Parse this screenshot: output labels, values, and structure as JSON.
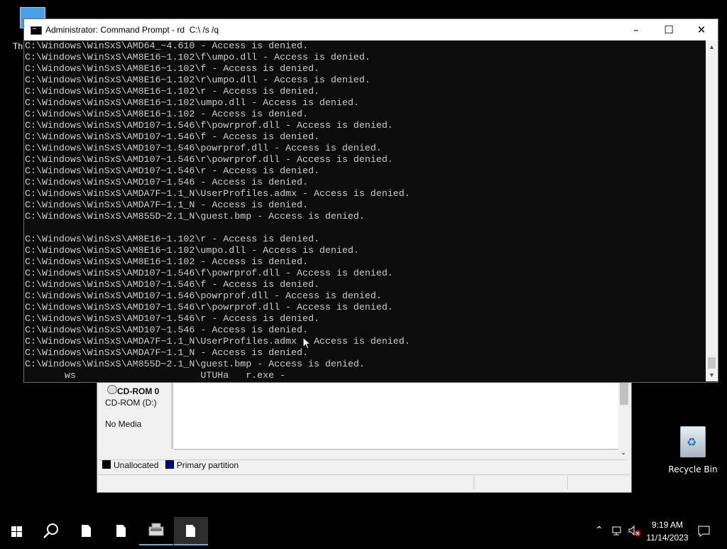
{
  "desktop": {
    "this_pc_label": "Th",
    "recycle_bin_label": "Recycle Bin"
  },
  "disk_management": {
    "disk_name": "CD-ROM 0",
    "disk_type": "CD-ROM (D:)",
    "disk_media": "No Media",
    "legend": [
      {
        "label": "Unallocated",
        "color": "#000000"
      },
      {
        "label": "Primary partition",
        "color": "#000080"
      }
    ]
  },
  "cmd": {
    "title": "Administrator: Command Prompt - rd  C:\\ /s /q",
    "lines": [
      "C:\\Windows\\WinSxS\\AMD64_~4.610 - Access is denied.",
      "C:\\Windows\\WinSxS\\AM8E16~1.102\\f\\umpo.dll - Access is denied.",
      "C:\\Windows\\WinSxS\\AM8E16~1.102\\f - Access is denied.",
      "C:\\Windows\\WinSxS\\AM8E16~1.102\\r\\umpo.dll - Access is denied.",
      "C:\\Windows\\WinSxS\\AM8E16~1.102\\r - Access is denied.",
      "C:\\Windows\\WinSxS\\AM8E16~1.102\\umpo.dll - Access is denied.",
      "C:\\Windows\\WinSxS\\AM8E16~1.102 - Access is denied.",
      "C:\\Windows\\WinSxS\\AMD107~1.546\\f\\powrprof.dll - Access is denied.",
      "C:\\Windows\\WinSxS\\AMD107~1.546\\f - Access is denied.",
      "C:\\Windows\\WinSxS\\AMD107~1.546\\powrprof.dll - Access is denied.",
      "C:\\Windows\\WinSxS\\AMD107~1.546\\r\\powrprof.dll - Access is denied.",
      "C:\\Windows\\WinSxS\\AMD107~1.546\\r - Access is denied.",
      "C:\\Windows\\WinSxS\\AMD107~1.546 - Access is denied.",
      "C:\\Windows\\WinSxS\\AMDA7F~1.1_N\\UserProfiles.admx - Access is denied.",
      "C:\\Windows\\WinSxS\\AMDA7F~1.1_N - Access is denied.",
      "C:\\Windows\\WinSxS\\AM855D~2.1_N\\guest.bmp - Access is denied.",
      "",
      "C:\\Windows\\WinSxS\\AM8E16~1.102\\r - Access is denied.",
      "C:\\Windows\\WinSxS\\AM8E16~1.102\\umpo.dll - Access is denied.",
      "C:\\Windows\\WinSxS\\AM8E16~1.102 - Access is denied.",
      "C:\\Windows\\WinSxS\\AMD107~1.546\\f\\powrprof.dll - Access is denied.",
      "C:\\Windows\\WinSxS\\AMD107~1.546\\f - Access is denied.",
      "C:\\Windows\\WinSxS\\AMD107~1.546\\powrprof.dll - Access is denied.",
      "C:\\Windows\\WinSxS\\AMD107~1.546\\r\\powrprof.dll - Access is denied.",
      "C:\\Windows\\WinSxS\\AMD107~1.546\\r - Access is denied.",
      "C:\\Windows\\WinSxS\\AMD107~1.546 - Access is denied.",
      "C:\\Windows\\WinSxS\\AMDA7F~1.1_N\\UserProfiles.admx - Access is denied.",
      "C:\\Windows\\WinSxS\\AMDA7F~1.1_N - Access is denied.",
      "C:\\Windows\\WinSxS\\AM855D~2.1_N\\guest.bmp - Access is denied.",
      "       ws                      UTUHa   r.exe -"
    ]
  },
  "taskbar": {
    "time": "9:19 AM",
    "date": "11/14/2023",
    "accent": "#77a7d8"
  }
}
